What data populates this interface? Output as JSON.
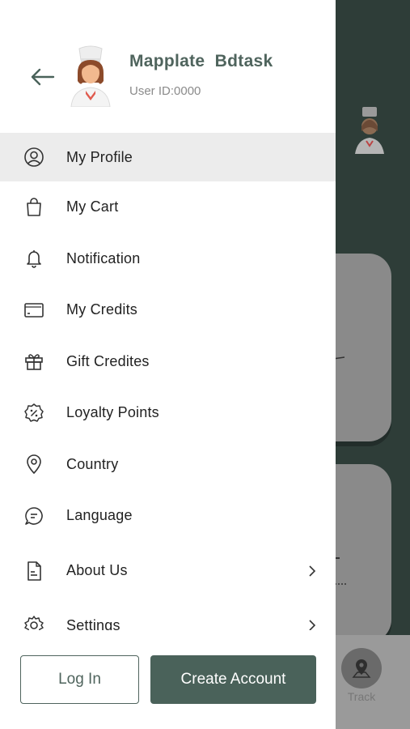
{
  "user": {
    "name": "Mapplate  Bdtask",
    "user_id": "User ID:0000"
  },
  "menu": {
    "items": [
      {
        "label": "My Profile",
        "icon": "user-circle-icon",
        "active": true
      },
      {
        "label": "My Cart",
        "icon": "shopping-bag-icon"
      },
      {
        "label": "Notification",
        "icon": "bell-icon"
      },
      {
        "label": "My Credits",
        "icon": "wallet-icon"
      },
      {
        "label": "Gift Credites",
        "icon": "gift-icon"
      },
      {
        "label": "Loyalty Points",
        "icon": "discount-badge-icon"
      },
      {
        "label": "Country",
        "icon": "location-pin-icon"
      },
      {
        "label": "Language",
        "icon": "chat-bubble-icon"
      },
      {
        "label": "About Us",
        "icon": "document-icon",
        "chevron": true
      },
      {
        "label": "Settings",
        "icon": "gear-icon",
        "chevron": true
      }
    ]
  },
  "footer": {
    "login_label": "Log In",
    "create_label": "Create Account"
  },
  "background": {
    "track_label": "Track"
  },
  "colors": {
    "accent": "#4a625a",
    "name_text": "#4f645d",
    "overlay": "#2e3d38",
    "active_row": "#ececec"
  }
}
